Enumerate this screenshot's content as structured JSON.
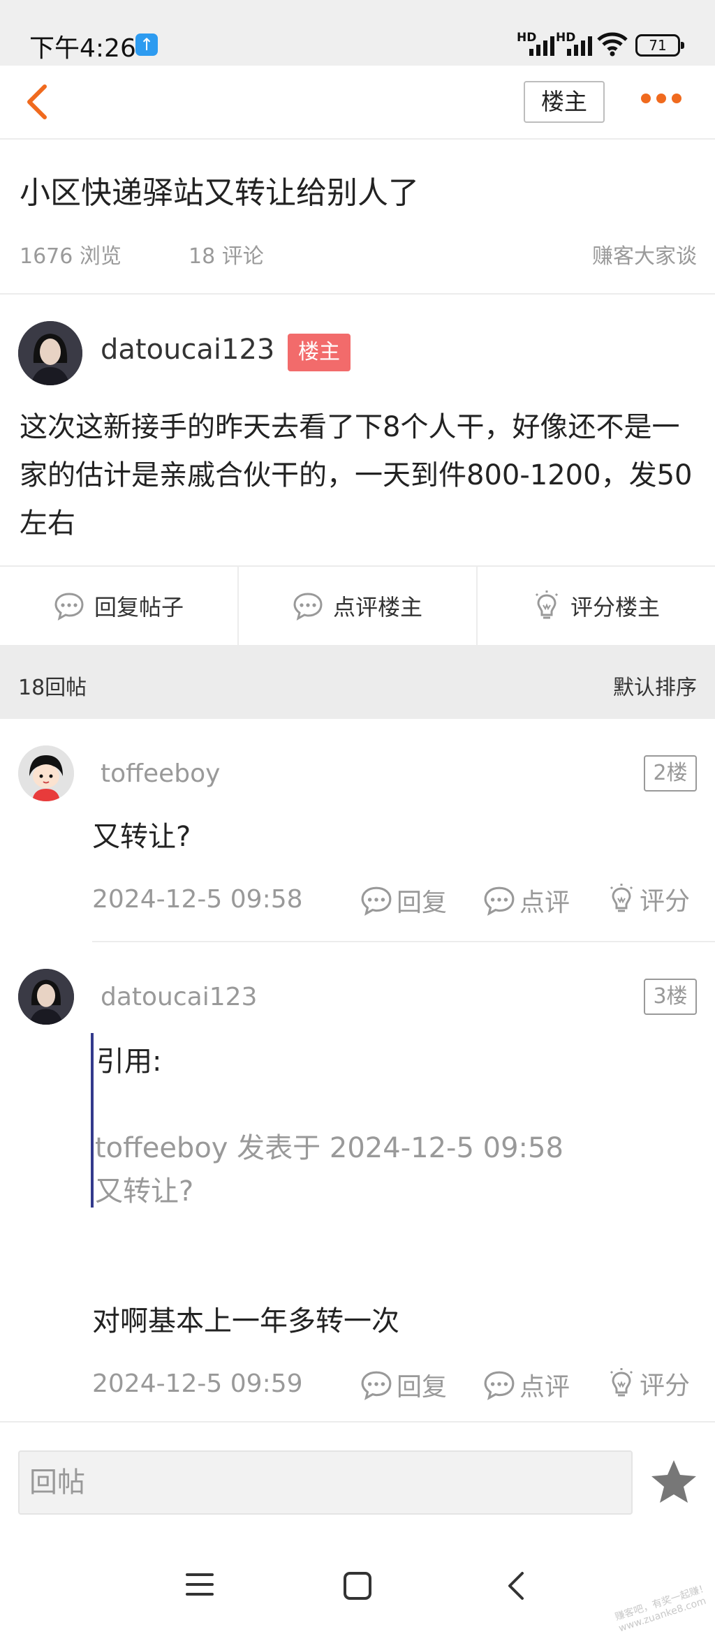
{
  "status_bar": {
    "time": "下午4:26",
    "signal_1": "HD",
    "signal_2": "HD",
    "battery": "71"
  },
  "nav": {
    "louzhu_button": "楼主"
  },
  "thread": {
    "title": "小区快递驿站又转让给别人了",
    "views": "1676 浏览",
    "comments": "18 评论",
    "forum": "赚客大家谈"
  },
  "op": {
    "username": "datoucai123",
    "badge": "楼主",
    "content": "这次这新接手的昨天去看了下8个人干，好像还不是一家的估计是亲戚合伙干的，一天到件800-1200，发50左右"
  },
  "actions": {
    "reply": "回复帖子",
    "comment": "点评楼主",
    "rate": "评分楼主"
  },
  "replies_bar": {
    "count": "18回帖",
    "sort": "默认排序"
  },
  "posts": [
    {
      "username": "toffeeboy",
      "floor": "2楼",
      "content": "又转让?",
      "time": "2024-12-5 09:58",
      "reply": "回复",
      "comment": "点评",
      "rate": "评分"
    },
    {
      "username": "datoucai123",
      "floor": "3楼",
      "quote_label": "引用:",
      "quote_meta": "toffeeboy 发表于 2024-12-5 09:58",
      "quote_text": "又转让?",
      "content": "对啊基本上一年多转一次",
      "time": "2024-12-5 09:59",
      "reply": "回复",
      "comment": "点评",
      "rate": "评分"
    }
  ],
  "bottom": {
    "reply_placeholder": "回帖"
  },
  "watermark": "赚客吧，有奖一起赚！ www.zuanke8.com",
  "colors": {
    "accent": "#f06a1e",
    "badge": "#f26b6b",
    "quote_bar": "#333a8c",
    "status_blue": "#2d9bf0"
  },
  "icons": {
    "back": "chevron-left-icon",
    "more": "more-dots-icon",
    "reply": "chat-bubble-icon",
    "rate": "lightbulb-icon",
    "favorite": "star-icon",
    "upload": "upload-arrow-icon",
    "menu": "menu-icon",
    "home": "home-square-icon",
    "sys_back": "back-chevron-icon"
  }
}
